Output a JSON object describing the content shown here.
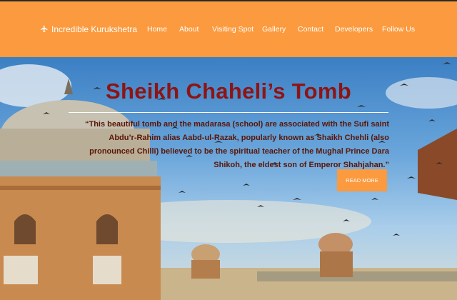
{
  "navbar": {
    "brand": "Incredible Kurukshetra",
    "brand_icon": "airplane-icon",
    "links": [
      "Home",
      "About",
      "Visiting Spot",
      "Gallery",
      "Contact",
      "Developers",
      "Follow Us"
    ],
    "background_color": "#fb9a3e"
  },
  "hero": {
    "title": "Sheikh Chaheli’s Tomb",
    "description": "“This beautiful tomb and the madarasa (school) are associated with the Sufi saint Abdu’r-Rahim alias Aabd-ul-Razak, popularly known as Shaikh Chehli (also pronounced Chilli) believed to be the spiritual teacher of the Mughal Prince Dara Shikoh, the eldest son of Emperor Shahjahan.”",
    "button_label": "READ MORE",
    "title_color": "#8e1414",
    "button_color": "#fb9a3e"
  }
}
